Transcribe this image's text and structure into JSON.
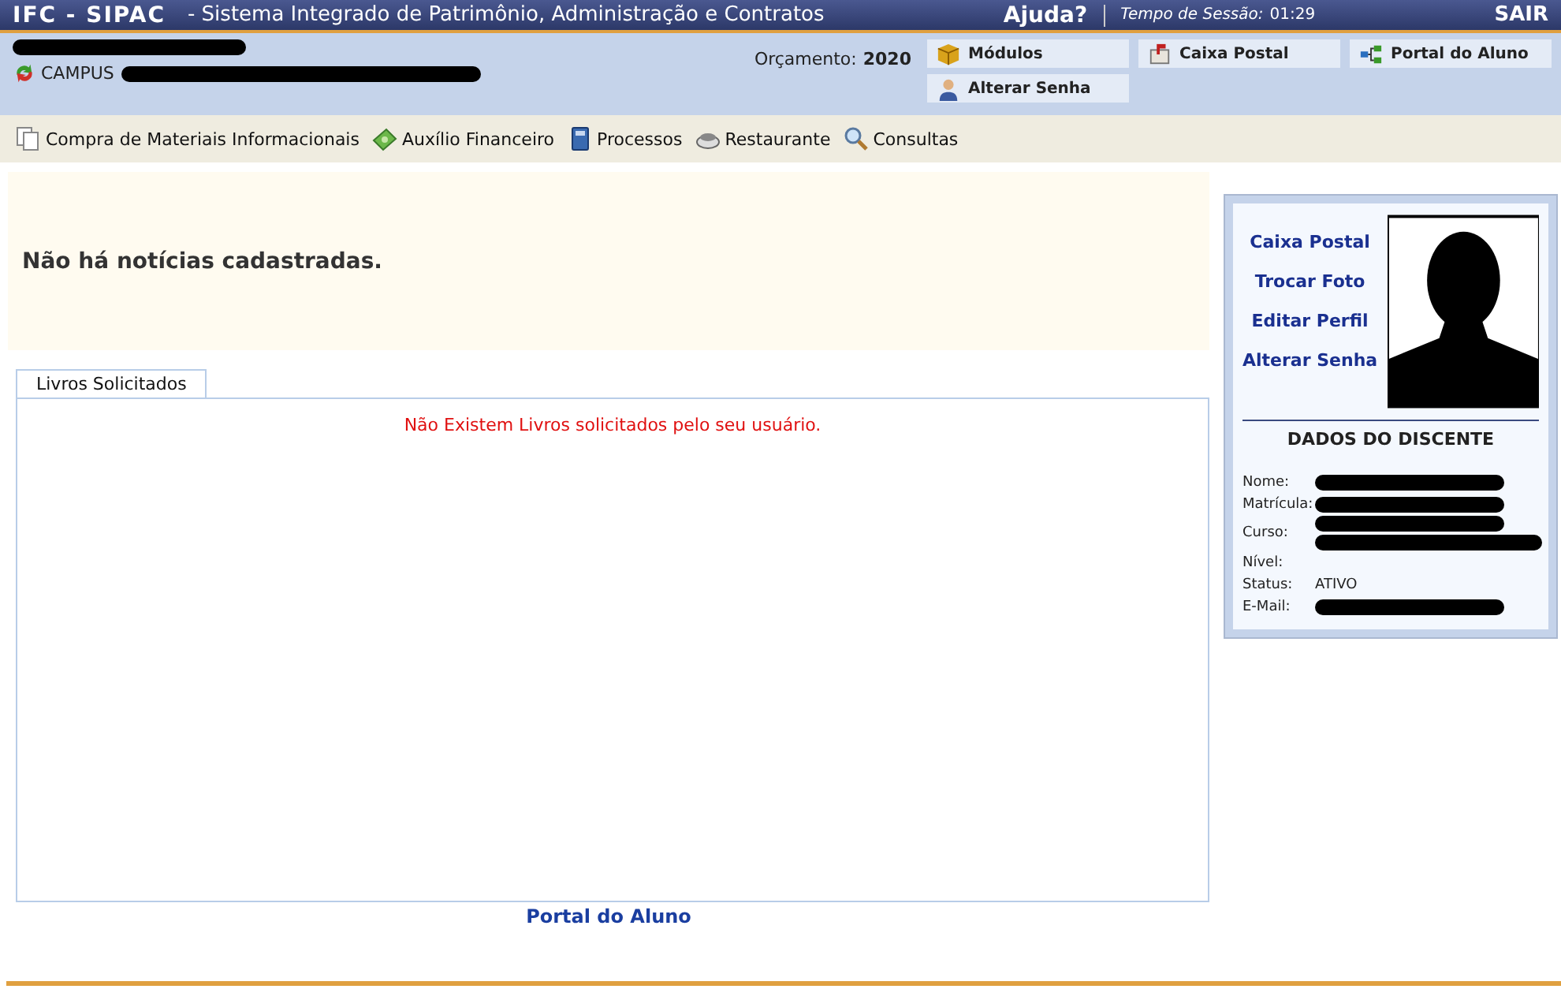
{
  "header": {
    "system": "IFC - SIPAC",
    "subtitle": "- Sistema Integrado de Patrimônio, Administração e Contratos",
    "help": "Ajuda?",
    "session_label": "Tempo de Sessão:",
    "session_time": "01:29",
    "logout": "SAIR"
  },
  "user_bar": {
    "name_redacted": true,
    "campus_label": "CAMPUS",
    "campus_redacted": true,
    "budget_label": "Orçamento:",
    "budget_year": "2020",
    "shortcuts": [
      {
        "label": "Módulos"
      },
      {
        "label": "Caixa Postal"
      },
      {
        "label": "Portal do Aluno"
      },
      {
        "label": "Alterar Senha"
      }
    ]
  },
  "menu": [
    {
      "label": "Compra de Materiais Informacionais"
    },
    {
      "label": "Auxílio Financeiro"
    },
    {
      "label": "Processos"
    },
    {
      "label": "Restaurante"
    },
    {
      "label": "Consultas"
    }
  ],
  "news": "Não há notícias cadastradas.",
  "tabs": [
    {
      "label": "Livros Solicitados",
      "selected": true
    }
  ],
  "tab_message": "Não Existem Livros solicitados pelo seu usuário.",
  "footer_link": "Portal do Aluno",
  "profile": {
    "links": [
      "Caixa Postal",
      "Trocar Foto",
      "Editar Perfil",
      "Alterar Senha"
    ],
    "title": "DADOS DO DISCENTE",
    "fields": [
      {
        "label": "Nome:",
        "redacted": true
      },
      {
        "label": "Matrícula:",
        "redacted": true
      },
      {
        "label": "Curso:",
        "redacted": true,
        "wrapped": true
      },
      {
        "label": "Nível:",
        "redacted": false
      },
      {
        "label": "Status:",
        "redacted": false,
        "value": "ATIVO"
      },
      {
        "label": "E-Mail:",
        "redacted": true
      }
    ]
  }
}
